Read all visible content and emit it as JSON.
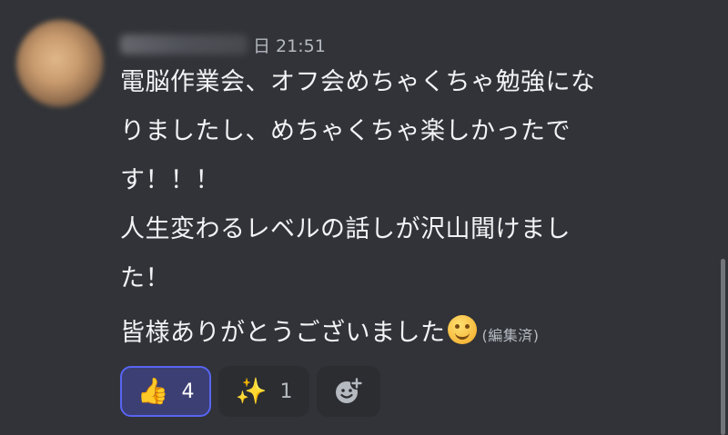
{
  "message": {
    "timestamp": "日 21:51",
    "lines": [
      "電脳作業会、オフ会めちゃくちゃ勉強にな",
      "りましたし、めちゃくちゃ楽しかったで",
      "す！！！",
      "人生変わるレベルの話しが沢山聞けまし",
      "た！"
    ],
    "last_line": "皆様ありがとうございました",
    "edited_label": "(編集済)"
  },
  "reactions": [
    {
      "emoji": "👍",
      "count": "4",
      "active": true
    },
    {
      "emoji": "✨",
      "count": "1",
      "active": false
    }
  ],
  "icons": [
    "thumbs-up-icon",
    "sparkles-icon",
    "add-reaction-icon",
    "smiling-face-emoji"
  ],
  "colors": {
    "background": "#313338",
    "accent": "#5865f2",
    "text": "#f2f3f5",
    "muted": "#b5bac1"
  }
}
